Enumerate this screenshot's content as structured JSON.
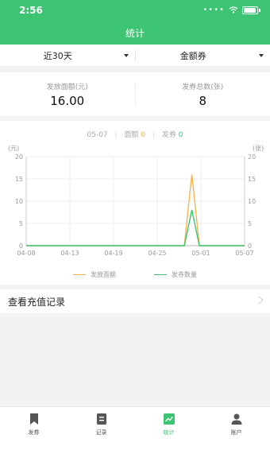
{
  "status_bar": {
    "time": "2:56"
  },
  "header": {
    "title": "统计"
  },
  "filters": {
    "period": "近30天",
    "metric": "金额券"
  },
  "stats": [
    {
      "label": "发放面额(元)",
      "value": "16.00"
    },
    {
      "label": "发券总数(张)",
      "value": "8"
    }
  ],
  "chart_legend_top": {
    "date": "05-07",
    "amount_label": "面额",
    "amount_value": "0",
    "coupon_label": "发券",
    "coupon_value": "0"
  },
  "chart_data": {
    "type": "line",
    "x_tick_labels": [
      "04-08",
      "04-13",
      "04-19",
      "04-25",
      "05-01",
      "05-07"
    ],
    "left_axis": {
      "label": "(元)",
      "ticks": [
        "0",
        "5",
        "10",
        "15",
        "20"
      ],
      "range": [
        0,
        20
      ]
    },
    "right_axis": {
      "label": "(张)",
      "ticks": [
        "0",
        "5",
        "10",
        "15",
        "20"
      ],
      "range": [
        0,
        20
      ]
    },
    "x": [
      "04-08",
      "04-09",
      "04-10",
      "04-11",
      "04-12",
      "04-13",
      "04-14",
      "04-15",
      "04-16",
      "04-17",
      "04-18",
      "04-19",
      "04-20",
      "04-21",
      "04-22",
      "04-23",
      "04-24",
      "04-25",
      "04-26",
      "04-27",
      "04-28",
      "04-29",
      "04-30",
      "05-01",
      "05-02",
      "05-03",
      "05-04",
      "05-05",
      "05-06",
      "05-07"
    ],
    "series": [
      {
        "name": "发放面额",
        "color": "#f5b453",
        "values": [
          0,
          0,
          0,
          0,
          0,
          0,
          0,
          0,
          0,
          0,
          0,
          0,
          0,
          0,
          0,
          0,
          0,
          0,
          0,
          0,
          0,
          0,
          16,
          0,
          0,
          0,
          0,
          0,
          0,
          0
        ]
      },
      {
        "name": "发券数量",
        "color": "#3cc472",
        "values": [
          0,
          0,
          0,
          0,
          0,
          0,
          0,
          0,
          0,
          0,
          0,
          0,
          0,
          0,
          0,
          0,
          0,
          0,
          0,
          0,
          0,
          0,
          8,
          0,
          0,
          0,
          0,
          0,
          0,
          0
        ]
      }
    ],
    "grid": true,
    "legend": "bottom-center"
  },
  "recharge_link": "查看充值记录",
  "tabs": [
    {
      "label": "发券",
      "icon": "bookmark-icon"
    },
    {
      "label": "记录",
      "icon": "list-icon"
    },
    {
      "label": "统计",
      "icon": "chart-icon"
    },
    {
      "label": "账户",
      "icon": "user-icon"
    }
  ],
  "colors": {
    "brand": "#3cc472",
    "amount": "#f5b453"
  }
}
